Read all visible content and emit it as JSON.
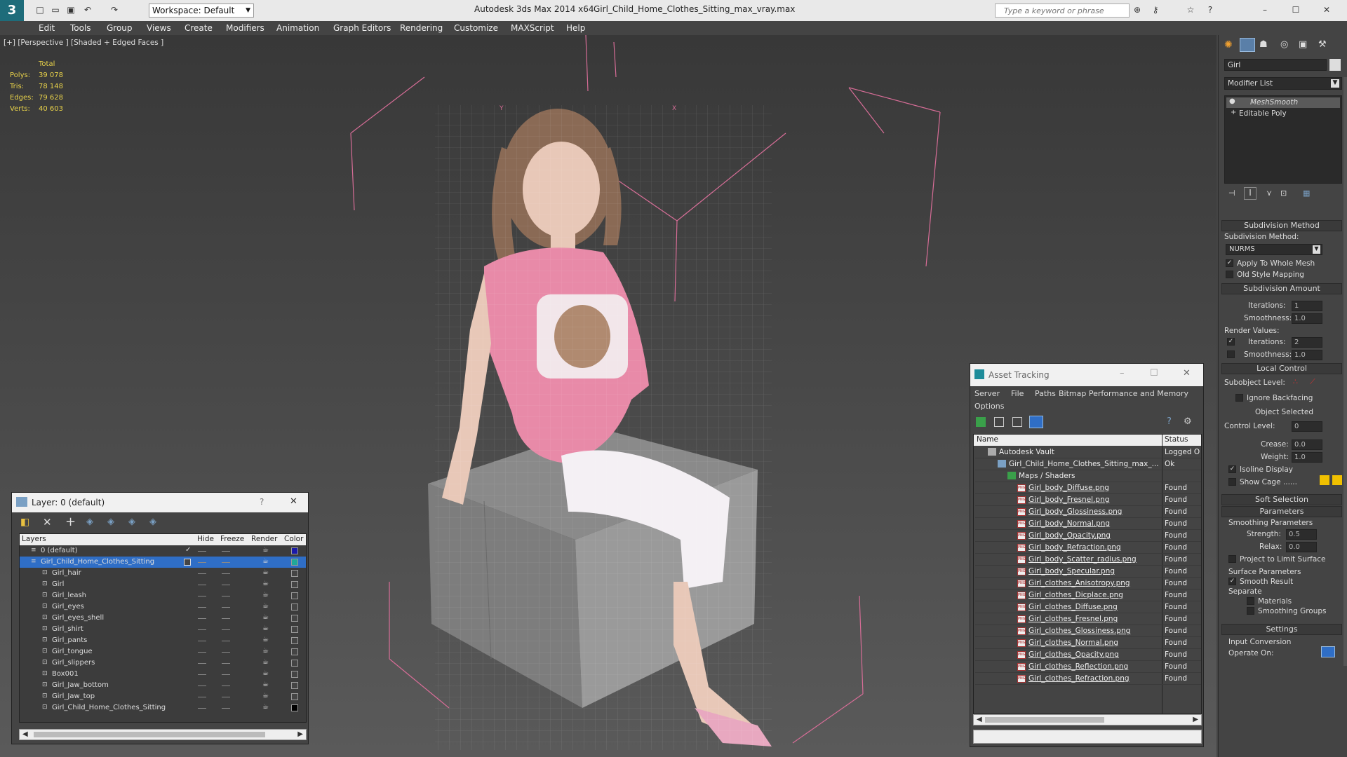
{
  "titlebar": {
    "workspace": "Workspace: Default",
    "app_title": "Autodesk 3ds Max  2014 x64",
    "file_title": "Girl_Child_Home_Clothes_Sitting_max_vray.max",
    "search_placeholder": "Type a keyword or phrase"
  },
  "menu": [
    "Edit",
    "Tools",
    "Group",
    "Views",
    "Create",
    "Modifiers",
    "Animation",
    "Graph Editors",
    "Rendering",
    "Customize",
    "MAXScript",
    "Help"
  ],
  "viewport": {
    "label": "[+] [Perspective ] [Shaded + Edged Faces ]",
    "stats": {
      "total": "Total",
      "rows": [
        [
          "Polys:",
          "39 078"
        ],
        [
          "Tris:",
          "78 148"
        ],
        [
          "Edges:",
          "79 628"
        ],
        [
          "Verts:",
          "40 603"
        ]
      ]
    }
  },
  "layer_dialog": {
    "title": "Layer: 0 (default)",
    "help": "?",
    "headers": [
      "Layers",
      "Hide",
      "Freeze",
      "Render",
      "Color"
    ],
    "rows": [
      {
        "name": "0 (default)",
        "level": 0,
        "color": "#1a1aa8"
      },
      {
        "name": "Girl_Child_Home_Clothes_Sitting",
        "level": 0,
        "color": "#1fa89a"
      },
      {
        "name": "Girl_hair",
        "level": 1,
        "color": "#444"
      },
      {
        "name": "Girl",
        "level": 1,
        "color": "#444"
      },
      {
        "name": "Girl_leash",
        "level": 1,
        "color": "#444"
      },
      {
        "name": "Girl_eyes",
        "level": 1,
        "color": "#444"
      },
      {
        "name": "Girl_eyes_shell",
        "level": 1,
        "color": "#444"
      },
      {
        "name": "Girl_shirt",
        "level": 1,
        "color": "#444"
      },
      {
        "name": "Girl_pants",
        "level": 1,
        "color": "#444"
      },
      {
        "name": "Girl_tongue",
        "level": 1,
        "color": "#444"
      },
      {
        "name": "Girl_slippers",
        "level": 1,
        "color": "#444"
      },
      {
        "name": "Box001",
        "level": 1,
        "color": "#444"
      },
      {
        "name": "Girl_Jaw_bottom",
        "level": 1,
        "color": "#444"
      },
      {
        "name": "Girl_Jaw_top",
        "level": 1,
        "color": "#444"
      },
      {
        "name": "Girl_Child_Home_Clothes_Sitting",
        "level": 1,
        "color": "#000"
      }
    ]
  },
  "asset_tracking": {
    "title": "Asset Tracking",
    "menu": [
      "Server",
      "File",
      "Paths",
      "Bitmap Performance and Memory",
      "Options"
    ],
    "col_name": "Name",
    "col_status": "Status",
    "rows": [
      {
        "name": "Autodesk Vault",
        "status": "Logged O",
        "indent": 0,
        "kind": "vault"
      },
      {
        "name": "Girl_Child_Home_Clothes_Sitting_max_...",
        "status": "Ok",
        "indent": 1,
        "kind": "file"
      },
      {
        "name": "Maps / Shaders",
        "status": "",
        "indent": 2,
        "kind": "folder"
      },
      {
        "name": "Girl_body_Diffuse.png",
        "status": "Found",
        "indent": 3,
        "kind": "png"
      },
      {
        "name": "Girl_body_Fresnel.png",
        "status": "Found",
        "indent": 3,
        "kind": "png"
      },
      {
        "name": "Girl_body_Glossiness.png",
        "status": "Found",
        "indent": 3,
        "kind": "png"
      },
      {
        "name": "Girl_body_Normal.png",
        "status": "Found",
        "indent": 3,
        "kind": "png"
      },
      {
        "name": "Girl_body_Opacity.png",
        "status": "Found",
        "indent": 3,
        "kind": "png"
      },
      {
        "name": "Girl_body_Refraction.png",
        "status": "Found",
        "indent": 3,
        "kind": "png"
      },
      {
        "name": "Girl_body_Scatter_radius.png",
        "status": "Found",
        "indent": 3,
        "kind": "png"
      },
      {
        "name": "Girl_body_Specular.png",
        "status": "Found",
        "indent": 3,
        "kind": "png"
      },
      {
        "name": "Girl_clothes_Anisotropy.png",
        "status": "Found",
        "indent": 3,
        "kind": "png"
      },
      {
        "name": "Girl_clothes_Dicplace.png",
        "status": "Found",
        "indent": 3,
        "kind": "png"
      },
      {
        "name": "Girl_clothes_Diffuse.png",
        "status": "Found",
        "indent": 3,
        "kind": "png"
      },
      {
        "name": "Girl_clothes_Fresnel.png",
        "status": "Found",
        "indent": 3,
        "kind": "png"
      },
      {
        "name": "Girl_clothes_Glossiness.png",
        "status": "Found",
        "indent": 3,
        "kind": "png"
      },
      {
        "name": "Girl_clothes_Normal.png",
        "status": "Found",
        "indent": 3,
        "kind": "png"
      },
      {
        "name": "Girl_clothes_Opacity.png",
        "status": "Found",
        "indent": 3,
        "kind": "png"
      },
      {
        "name": "Girl_clothes_Reflection.png",
        "status": "Found",
        "indent": 3,
        "kind": "png"
      },
      {
        "name": "Girl_clothes_Refraction.png",
        "status": "Found",
        "indent": 3,
        "kind": "png"
      }
    ]
  },
  "command_panel": {
    "object_name": "Girl",
    "modifier_list": "Modifier List",
    "stack": [
      "MeshSmooth",
      "Editable Poly"
    ],
    "subdiv_method_hdr": "Subdivision Method",
    "subdiv_method_lbl": "Subdivision Method:",
    "subdiv_method_val": "NURMS",
    "apply_whole": "Apply To Whole Mesh",
    "old_style": "Old Style Mapping",
    "subdiv_amount_hdr": "Subdivision Amount",
    "iterations_lbl": "Iterations:",
    "iterations_val": "1",
    "smoothness_lbl": "Smoothness:",
    "smoothness_val": "1.0",
    "render_values": "Render Values:",
    "r_iterations_lbl": "Iterations:",
    "r_iterations_val": "2",
    "r_smoothness_lbl": "Smoothness:",
    "r_smoothness_val": "1.0",
    "local_control_hdr": "Local Control",
    "subobject_lbl": "Subobject Level:",
    "ignore_backfacing": "Ignore Backfacing",
    "object_selected": "Object Selected",
    "control_level_lbl": "Control Level:",
    "control_level_val": "0",
    "crease_lbl": "Crease:",
    "crease_val": "0.0",
    "weight_lbl": "Weight:",
    "weight_val": "1.0",
    "isoline": "Isoline Display",
    "show_cage": "Show Cage ......",
    "soft_selection_hdr": "Soft Selection",
    "parameters_hdr": "Parameters",
    "smoothing_params": "Smoothing Parameters",
    "strength_lbl": "Strength:",
    "strength_val": "0.5",
    "relax_lbl": "Relax:",
    "relax_val": "0.0",
    "project_limit": "Project to Limit Surface",
    "surface_params": "Surface Parameters",
    "smooth_result": "Smooth Result",
    "separate": "Separate",
    "materials": "Materials",
    "smoothing_groups": "Smoothing Groups",
    "settings_hdr": "Settings",
    "input_conversion": "Input Conversion",
    "operate_on": "Operate On:"
  },
  "colors": {
    "accent": "#2f6ec6",
    "stats_yellow": "#e8d24a",
    "cage_yellow": "#f0c000",
    "pink": "#d76d97"
  }
}
